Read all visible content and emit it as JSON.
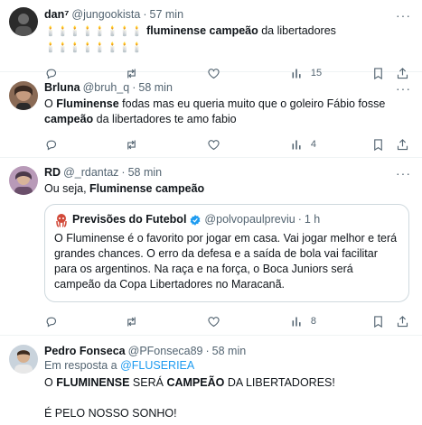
{
  "tweets": [
    {
      "name": "dan⁷",
      "handle": "@jungookista",
      "time": "57 min",
      "pre": "🕯️🕯️🕯️🕯️🕯️🕯️🕯️🕯️",
      "t1": "fluminense",
      "t2": " ",
      "t3": "campeão",
      "t4": " da libertadores ",
      "post": "🕯️🕯️🕯️🕯️🕯️🕯️🕯️🕯️",
      "views": "15"
    },
    {
      "name": "Brluna",
      "handle": "@bruh_q",
      "time": "58 min",
      "t0": "O ",
      "t1": "Fluminense",
      "t2": " fodas mas eu queria muito que o goleiro Fábio fosse ",
      "t3": "campeão",
      "t4": " da libertadores te amo fabio",
      "views": "4"
    },
    {
      "name": "RD",
      "handle": "@_rdantaz",
      "time": "58 min",
      "t0": "Ou seja, ",
      "t1": "Fluminense campeão",
      "quote": {
        "name": "Previsões do Futebol",
        "handle": "@polvopaulpreviu",
        "time": "1 h",
        "text": "O Fluminense é o favorito por jogar  em casa. Vai jogar melhor e terá grandes chances. O erro da defesa e a saída de bola vai facilitar para os argentinos. Na raça e na força, o Boca Juniors será campeão da Copa Libertadores no Maracanã."
      },
      "views": "8"
    },
    {
      "name": "Pedro Fonseca",
      "handle": "@PFonseca89",
      "time": "58 min",
      "reply_prefix": "Em resposta a ",
      "reply_to": "@FLUSERIEA",
      "t0": "O ",
      "t1": "FLUMINENSE",
      "t2": " SERÁ ",
      "t3": "CAMPEÃO",
      "t4": " DA LIBERTADORES!",
      "line2": "É PELO NOSSO SONHO!"
    }
  ],
  "dot": "·",
  "more": "···",
  "colors": {
    "accent": "#1d9bf0",
    "muted": "#536471",
    "border": "#eff3f4"
  }
}
